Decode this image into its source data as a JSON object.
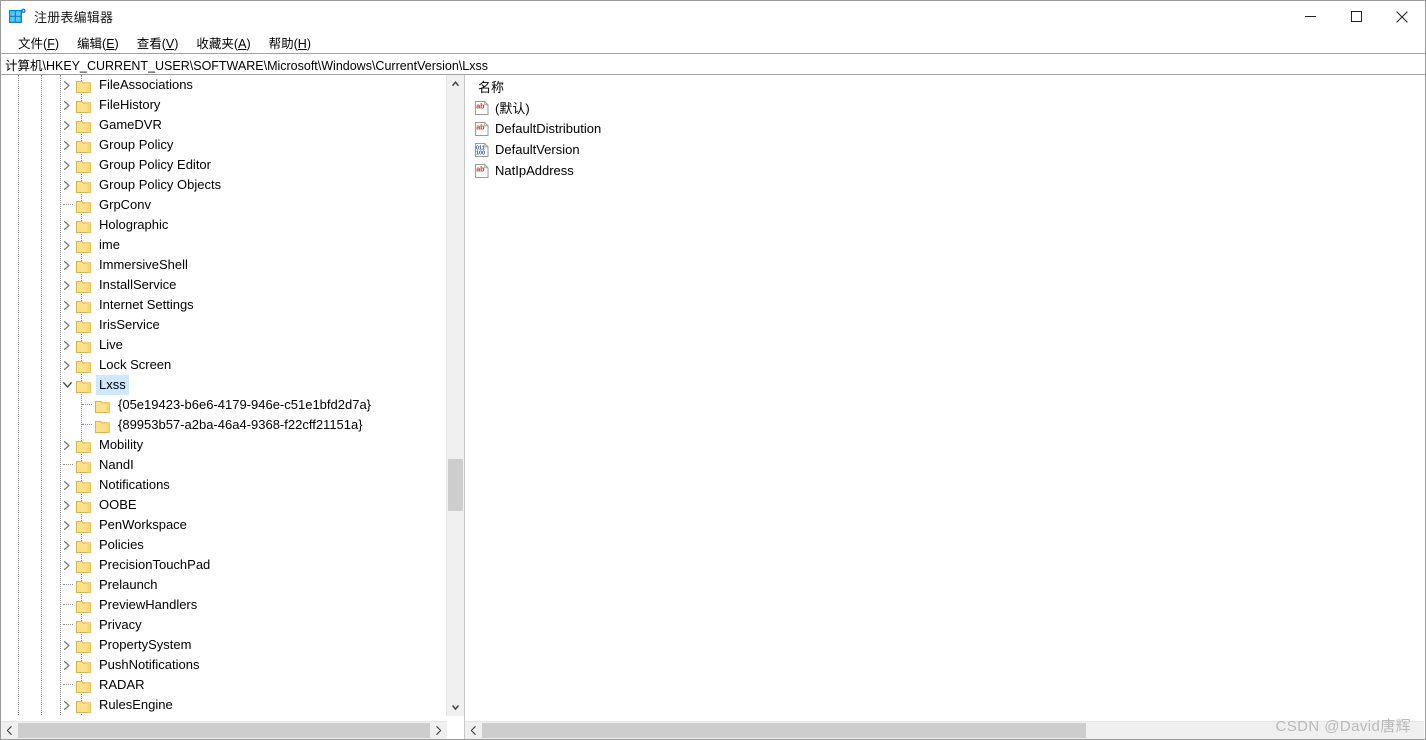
{
  "window": {
    "title": "注册表编辑器",
    "app_icon": "registry-editor-icon",
    "controls": {
      "minimize": "minimize-icon",
      "maximize": "maximize-icon",
      "close": "close-icon"
    }
  },
  "menubar": [
    {
      "label": "文件",
      "accel": "F"
    },
    {
      "label": "编辑",
      "accel": "E"
    },
    {
      "label": "查看",
      "accel": "V"
    },
    {
      "label": "收藏夹",
      "accel": "A"
    },
    {
      "label": "帮助",
      "accel": "H"
    }
  ],
  "address": {
    "path": "计算机\\HKEY_CURRENT_USER\\SOFTWARE\\Microsoft\\Windows\\CurrentVersion\\Lxss"
  },
  "tree": {
    "items": [
      {
        "label": "FileAssociations",
        "indent": 4,
        "state": "collapsed",
        "selected": false
      },
      {
        "label": "FileHistory",
        "indent": 4,
        "state": "collapsed",
        "selected": false
      },
      {
        "label": "GameDVR",
        "indent": 4,
        "state": "collapsed",
        "selected": false
      },
      {
        "label": "Group Policy",
        "indent": 4,
        "state": "collapsed",
        "selected": false
      },
      {
        "label": "Group Policy Editor",
        "indent": 4,
        "state": "collapsed",
        "selected": false
      },
      {
        "label": "Group Policy Objects",
        "indent": 4,
        "state": "collapsed",
        "selected": false
      },
      {
        "label": "GrpConv",
        "indent": 4,
        "state": "leaf",
        "selected": false
      },
      {
        "label": "Holographic",
        "indent": 4,
        "state": "collapsed",
        "selected": false
      },
      {
        "label": "ime",
        "indent": 4,
        "state": "collapsed",
        "selected": false
      },
      {
        "label": "ImmersiveShell",
        "indent": 4,
        "state": "collapsed",
        "selected": false
      },
      {
        "label": "InstallService",
        "indent": 4,
        "state": "collapsed",
        "selected": false
      },
      {
        "label": "Internet Settings",
        "indent": 4,
        "state": "collapsed",
        "selected": false
      },
      {
        "label": "IrisService",
        "indent": 4,
        "state": "collapsed",
        "selected": false
      },
      {
        "label": "Live",
        "indent": 4,
        "state": "collapsed",
        "selected": false
      },
      {
        "label": "Lock Screen",
        "indent": 4,
        "state": "collapsed",
        "selected": false
      },
      {
        "label": "Lxss",
        "indent": 4,
        "state": "expanded",
        "selected": true
      },
      {
        "label": "{05e19423-b6e6-4179-946e-c51e1bfd2d7a}",
        "indent": 5,
        "state": "leaf",
        "selected": false
      },
      {
        "label": "{89953b57-a2ba-46a4-9368-f22cff21151a}",
        "indent": 5,
        "state": "leaf",
        "selected": false
      },
      {
        "label": "Mobility",
        "indent": 4,
        "state": "collapsed",
        "selected": false
      },
      {
        "label": "NandI",
        "indent": 4,
        "state": "leaf",
        "selected": false
      },
      {
        "label": "Notifications",
        "indent": 4,
        "state": "collapsed",
        "selected": false
      },
      {
        "label": "OOBE",
        "indent": 4,
        "state": "collapsed",
        "selected": false
      },
      {
        "label": "PenWorkspace",
        "indent": 4,
        "state": "collapsed",
        "selected": false
      },
      {
        "label": "Policies",
        "indent": 4,
        "state": "collapsed",
        "selected": false
      },
      {
        "label": "PrecisionTouchPad",
        "indent": 4,
        "state": "collapsed",
        "selected": false
      },
      {
        "label": "Prelaunch",
        "indent": 4,
        "state": "leaf",
        "selected": false
      },
      {
        "label": "PreviewHandlers",
        "indent": 4,
        "state": "leaf",
        "selected": false
      },
      {
        "label": "Privacy",
        "indent": 4,
        "state": "leaf",
        "selected": false
      },
      {
        "label": "PropertySystem",
        "indent": 4,
        "state": "collapsed",
        "selected": false
      },
      {
        "label": "PushNotifications",
        "indent": 4,
        "state": "collapsed",
        "selected": false
      },
      {
        "label": "RADAR",
        "indent": 4,
        "state": "leaf",
        "selected": false
      },
      {
        "label": "RulesEngine",
        "indent": 4,
        "state": "collapsed",
        "selected": false
      }
    ]
  },
  "values": {
    "column_header": "名称",
    "rows": [
      {
        "name": "(默认)",
        "icon": "string-value-icon"
      },
      {
        "name": "DefaultDistribution",
        "icon": "string-value-icon"
      },
      {
        "name": "DefaultVersion",
        "icon": "dword-value-icon"
      },
      {
        "name": "NatIpAddress",
        "icon": "string-value-icon"
      }
    ]
  },
  "watermark": {
    "text": "CSDN @David唐辉"
  },
  "colors": {
    "selection": "#cde8ff",
    "folder": "#ffe18a",
    "folder_edge": "#e8b43a",
    "string_icon": "#c33b1e",
    "dword_icon": "#1d4fc4",
    "scrollbar_thumb": "#cdcdcd",
    "scrollbar_track": "#f0f0f0"
  }
}
